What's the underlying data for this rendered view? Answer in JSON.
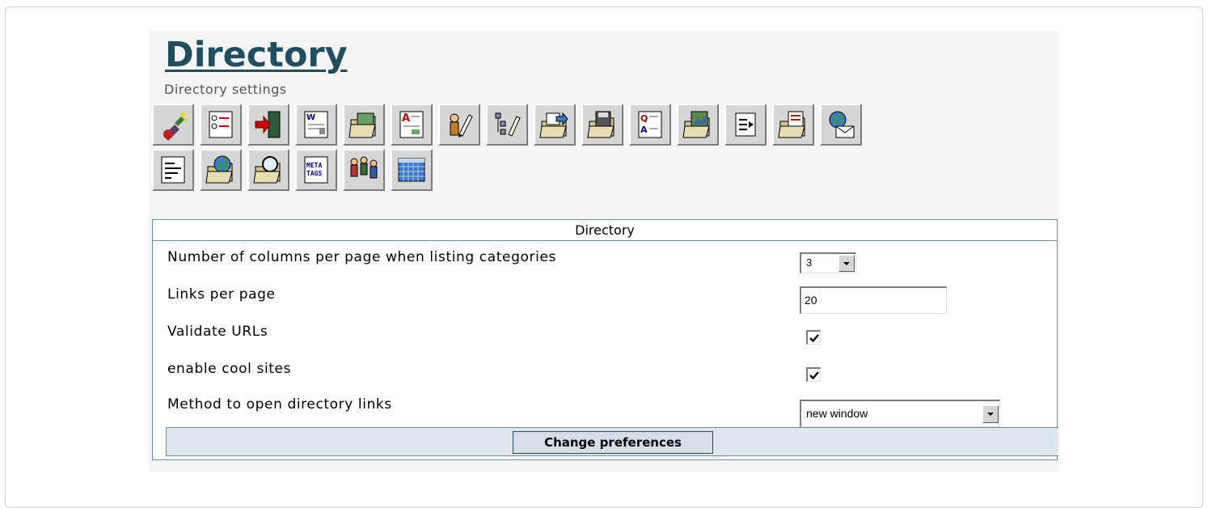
{
  "page": {
    "title": "Directory",
    "subtitle": "Directory settings"
  },
  "toolbar": {
    "row1": [
      {
        "icon": "admin-wand-icon"
      },
      {
        "icon": "list-options-icon"
      },
      {
        "icon": "login-door-icon"
      },
      {
        "icon": "word-document-icon"
      },
      {
        "icon": "image-folder-icon"
      },
      {
        "icon": "article-document-icon"
      },
      {
        "icon": "user-edit-icon"
      },
      {
        "icon": "structure-edit-icon"
      },
      {
        "icon": "folder-export-icon"
      },
      {
        "icon": "folder-save-icon"
      },
      {
        "icon": "faq-document-icon"
      },
      {
        "icon": "gallery-folder-icon"
      },
      {
        "icon": "redirect-icon"
      },
      {
        "icon": "document-folder-icon"
      },
      {
        "icon": "newsletter-globe-icon"
      }
    ],
    "row2": [
      {
        "icon": "text-lines-icon"
      },
      {
        "icon": "globe-folder-icon"
      },
      {
        "icon": "search-folder-icon"
      },
      {
        "icon": "meta-tags-icon",
        "label": "META TAGS"
      },
      {
        "icon": "users-group-icon"
      },
      {
        "icon": "calendar-grid-icon"
      }
    ]
  },
  "table": {
    "header": "Directory",
    "rows": {
      "columns": {
        "label": "Number of columns per page when listing categories",
        "value": "3"
      },
      "links_per_page": {
        "label": "Links per page",
        "value": "20"
      },
      "validate_urls": {
        "label": "Validate URLs",
        "checked": true
      },
      "cool_sites": {
        "label": "enable cool sites",
        "checked": true
      },
      "open_method": {
        "label": "Method to open directory links",
        "value": "new window"
      }
    },
    "submit_label": "Change preferences"
  },
  "colors": {
    "title": "#1f4f5f",
    "table_border": "#6a8ea0",
    "footer_bg": "#dfe7ee",
    "panel_bg": "#f5f5f5"
  }
}
